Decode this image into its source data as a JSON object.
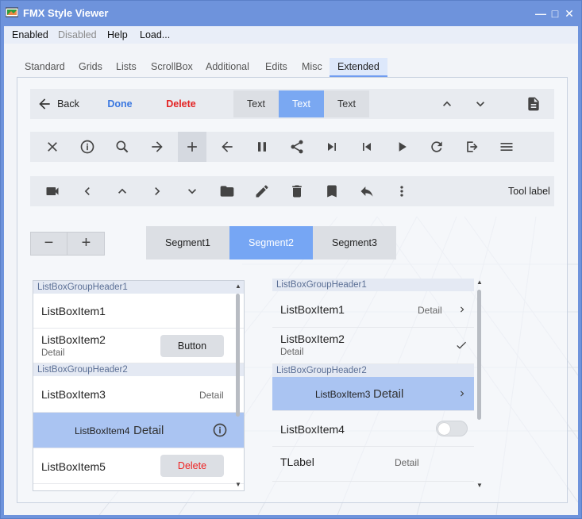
{
  "window": {
    "title": "FMX Style Viewer"
  },
  "menu": {
    "items": [
      "Enabled",
      "Disabled",
      "Help",
      "Load..."
    ]
  },
  "tabs": [
    "Standard",
    "Grids",
    "Lists",
    "ScrollBox",
    "Additional",
    "Edits",
    "Misc",
    "Extended"
  ],
  "active_tab": "Extended",
  "toolbar1": {
    "back_label": "Back",
    "done_label": "Done",
    "delete_label": "Delete",
    "segments": [
      "Text",
      "Text",
      "Text"
    ],
    "selected_segment": 1
  },
  "toolbar2": {
    "icons": [
      "close-icon",
      "info-icon",
      "search-icon",
      "arrow-right-icon",
      "plus-icon",
      "arrow-left-icon",
      "pause-icon",
      "share-icon",
      "skip-next-icon",
      "skip-previous-icon",
      "play-icon",
      "refresh-icon",
      "exit-icon",
      "menu-icon"
    ],
    "selected_icon": "plus-icon"
  },
  "toolbar3": {
    "icons": [
      "camera-icon",
      "chevron-left-icon",
      "chevron-up-icon",
      "chevron-right-icon",
      "chevron-down-icon",
      "folder-icon",
      "pencil-icon",
      "trash-icon",
      "bookmark-icon",
      "reply-icon",
      "more-vertical-icon"
    ],
    "tool_label": "Tool label"
  },
  "stepper": {
    "minus": "−",
    "plus": "+"
  },
  "segments": {
    "items": [
      "Segment1",
      "Segment2",
      "Segment3"
    ],
    "selected": "Segment2"
  },
  "listbox_left": {
    "group1": "ListBoxGroupHeader1",
    "item1": "ListBoxItem1",
    "item2": "ListBoxItem2",
    "item2_detail": "Detail",
    "item2_button": "Button",
    "group2": "ListBoxGroupHeader2",
    "item3": "ListBoxItem3",
    "item3_detail": "Detail",
    "item4": "ListBoxItem4",
    "item4_detail": "Detail",
    "item5": "ListBoxItem5",
    "item5_button": "Delete"
  },
  "listbox_right": {
    "group1": "ListBoxGroupHeader1",
    "item1": "ListBoxItem1",
    "item1_detail": "Detail",
    "item2": "ListBoxItem2",
    "item2_detail": "Detail",
    "group2": "ListBoxGroupHeader2",
    "item3": "ListBoxItem3",
    "item3_detail": "Detail",
    "item4": "ListBoxItem4",
    "item4_toggle": false,
    "label": "TLabel",
    "label_detail": "Detail"
  },
  "colors": {
    "titlebar": "#6e93dc",
    "accent": "#76a6f4",
    "selected_row": "#aac4f2",
    "delete": "#e32222",
    "done": "#3b78e0"
  }
}
